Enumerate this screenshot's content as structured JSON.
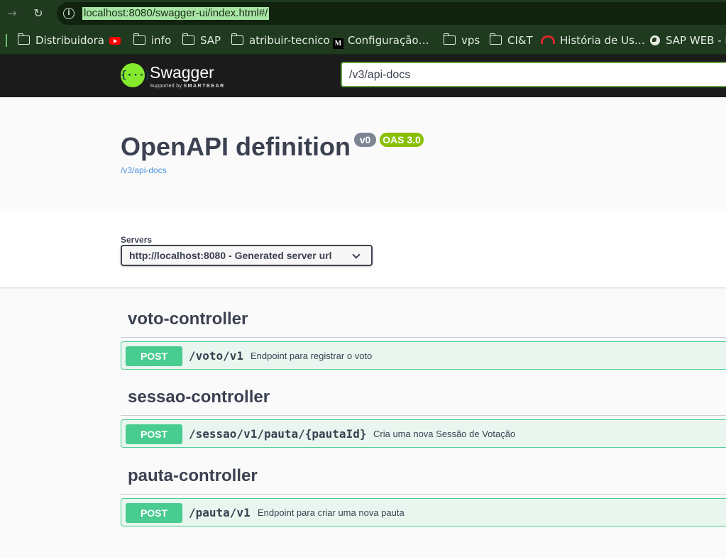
{
  "browser": {
    "url": "localhost:8080/swagger-ui/index.html#/",
    "bookmarks": [
      "Distribuidora",
      "info",
      "SAP",
      "atribuir-tecnico",
      "Configuração…",
      "vps",
      "CI&T",
      "História de Us…",
      "SAP WEB - Pa"
    ]
  },
  "swagger": {
    "logo_text": "Swagger",
    "logo_sub_prefix": "Supported by",
    "logo_sub_brand": "SMARTBEAR",
    "spec_url": "/v3/api-docs"
  },
  "info": {
    "title": "OpenAPI definition",
    "version_badge": "v0",
    "oas_badge": "OAS 3.0",
    "link": "/v3/api-docs"
  },
  "servers": {
    "label": "Servers",
    "selected": "http://localhost:8080 - Generated server url"
  },
  "tags": [
    {
      "name": "voto-controller",
      "op": {
        "method": "POST",
        "path": "/voto/v1",
        "summary": "Endpoint para registrar o voto"
      }
    },
    {
      "name": "sessao-controller",
      "op": {
        "method": "POST",
        "path": "/sessao/v1/pauta/{pautaId}",
        "summary": "Cria uma nova Sessão de Votação"
      }
    },
    {
      "name": "pauta-controller",
      "op": {
        "method": "POST",
        "path": "/pauta/v1",
        "summary": "Endpoint para criar uma nova pauta"
      }
    }
  ],
  "colors": {
    "post": "#49cc90",
    "post_bg": "#e8f6ef",
    "swagger_green": "#85ea2d",
    "browser_bar": "#1f3a1f"
  }
}
